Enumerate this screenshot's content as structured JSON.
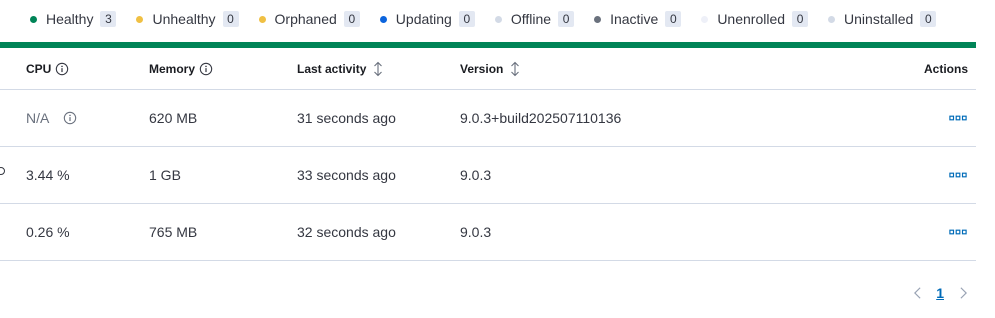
{
  "status_summary": [
    {
      "label": "Healthy",
      "count": "3",
      "color": "#008457"
    },
    {
      "label": "Unhealthy",
      "count": "0",
      "color": "#f0c043"
    },
    {
      "label": "Orphaned",
      "count": "0",
      "color": "#f0c043"
    },
    {
      "label": "Updating",
      "count": "0",
      "color": "#0b64dd"
    },
    {
      "label": "Offline",
      "count": "0",
      "color": "#d3dae6"
    },
    {
      "label": "Inactive",
      "count": "0",
      "color": "#6a717d"
    },
    {
      "label": "Unenrolled",
      "count": "0",
      "color": "#eef0f8"
    },
    {
      "label": "Uninstalled",
      "count": "0",
      "color": "#d3dae6"
    }
  ],
  "health_bar": {
    "color": "#008457"
  },
  "table": {
    "columns": {
      "cpu": "CPU",
      "memory": "Memory",
      "last_activity": "Last activity",
      "version": "Version",
      "actions": "Actions"
    },
    "rows": [
      {
        "cpu": "N/A",
        "memory": "620 MB",
        "last_activity": "31 seconds ago",
        "version": "9.0.3+build202507110136"
      },
      {
        "cpu": "3.44 %",
        "memory": "1 GB",
        "last_activity": "33 seconds ago",
        "version": "9.0.3"
      },
      {
        "cpu": "0.26 %",
        "memory": "765 MB",
        "last_activity": "32 seconds ago",
        "version": "9.0.3"
      }
    ]
  },
  "pagination": {
    "current_page": "1"
  },
  "icons": {
    "info": "info-icon",
    "sort": "sort-icon",
    "actions": "more-actions-icon",
    "prev": "chevron-left-icon",
    "next": "chevron-right-icon"
  }
}
